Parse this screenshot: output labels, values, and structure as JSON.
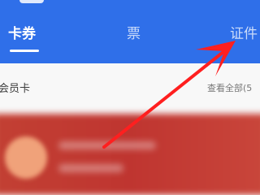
{
  "tabs": [
    {
      "label": "卡券",
      "active": true
    },
    {
      "label": "票",
      "active": false
    },
    {
      "label": "证件",
      "active": false
    }
  ],
  "section": {
    "title": "会员卡",
    "view_all": "查看全部(5"
  },
  "colors": {
    "primary": "#2f6fe9",
    "card": "#c24033",
    "annotation_arrow": "#ff1f1f"
  }
}
